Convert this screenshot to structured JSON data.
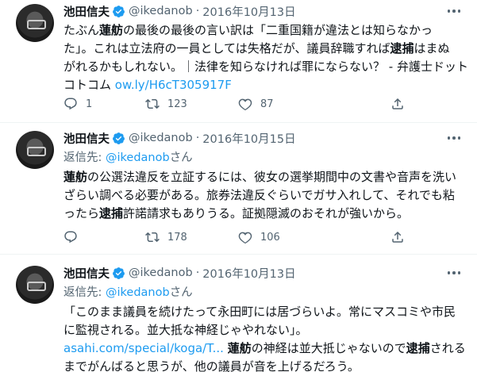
{
  "tweets": [
    {
      "name": "池田信夫",
      "handle": "@ikedanob",
      "date": "2016年10月13日",
      "reply_prefix": "",
      "reply_handle": "",
      "reply_suffix": "",
      "lines": [
        [
          {
            "t": "たぶん"
          },
          {
            "t": "蓮舫",
            "b": true
          },
          {
            "t": "の最後の最後の言い訳は「二重国籍が違法とは知らなかっ"
          }
        ],
        [
          {
            "t": "た」。これは立法府の一員としては失格だが、議員辞職すれば"
          },
          {
            "t": "逮捕",
            "b": true
          },
          {
            "t": "はまぬ"
          }
        ],
        [
          {
            "t": "がれるかもしれない。｜法律を知らなければ罪にならない？ - 弁護士ドット"
          }
        ],
        [
          {
            "t": "コトコム "
          },
          {
            "t": "ow.ly/H6cT305917F",
            "link": true
          }
        ]
      ],
      "replies": "1",
      "retweets": "123",
      "likes": "87"
    },
    {
      "name": "池田信夫",
      "handle": "@ikedanob",
      "date": "2016年10月15日",
      "reply_prefix": "返信先: ",
      "reply_handle": "@ikedanob",
      "reply_suffix": "さん",
      "lines": [
        [
          {
            "t": "蓮舫",
            "b": true
          },
          {
            "t": "の公選法違反を立証するには、彼女の選挙期間中の文書や音声を洗い"
          }
        ],
        [
          {
            "t": "ざらい調べる必要がある。旅券法違反ぐらいでガサ入れして、それでも粘"
          }
        ],
        [
          {
            "t": "ったら"
          },
          {
            "t": "逮捕",
            "b": true
          },
          {
            "t": "許諾請求もありうる。証拠隠滅のおそれが強いから。"
          }
        ]
      ],
      "replies": "",
      "retweets": "178",
      "likes": "106"
    },
    {
      "name": "池田信夫",
      "handle": "@ikedanob",
      "date": "2016年10月13日",
      "reply_prefix": "返信先: ",
      "reply_handle": "@ikedanob",
      "reply_suffix": "さん",
      "lines": [
        [
          {
            "t": "「このまま議員を続けたって永田町には居づらいよ。常にマスコミや市民"
          }
        ],
        [
          {
            "t": "に監視される。並大抵な神経じゃやれない」。"
          }
        ],
        [
          {
            "t": "asahi.com/special/koga/T...",
            "link": true
          },
          {
            "t": " "
          },
          {
            "t": "蓮舫",
            "b": true
          },
          {
            "t": "の神経は並大抵じゃないので"
          },
          {
            "t": "逮捕",
            "b": true
          },
          {
            "t": "される"
          }
        ],
        [
          {
            "t": "までがんばると思うが、他の議員が音を上げるだろう。"
          }
        ]
      ],
      "replies": "",
      "retweets": "",
      "likes": ""
    }
  ],
  "icons": {
    "verified": "verified-badge-icon",
    "more": "more-options-icon",
    "reply": "reply-icon",
    "retweet": "retweet-icon",
    "like": "like-icon",
    "share": "share-icon"
  },
  "colors": {
    "accent": "#1d9bf0",
    "text": "#0f1419",
    "muted": "#536471",
    "divider": "#eff3f4"
  }
}
